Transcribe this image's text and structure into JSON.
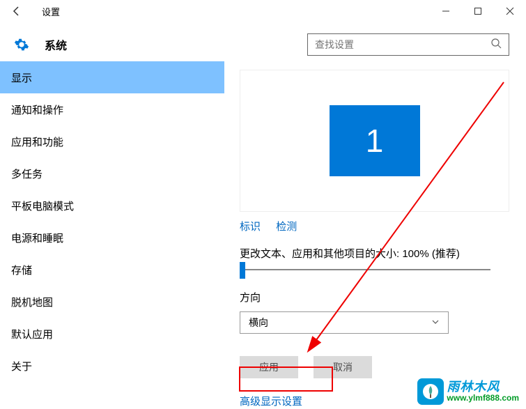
{
  "window": {
    "title": "设置"
  },
  "header": {
    "title": "系统",
    "search_placeholder": "查找设置"
  },
  "sidebar": {
    "items": [
      {
        "label": "显示"
      },
      {
        "label": "通知和操作"
      },
      {
        "label": "应用和功能"
      },
      {
        "label": "多任务"
      },
      {
        "label": "平板电脑模式"
      },
      {
        "label": "电源和睡眠"
      },
      {
        "label": "存储"
      },
      {
        "label": "脱机地图"
      },
      {
        "label": "默认应用"
      },
      {
        "label": "关于"
      }
    ]
  },
  "main": {
    "monitor_number": "1",
    "identify_link": "标识",
    "detect_link": "检测",
    "scale_label": "更改文本、应用和其他项目的大小: 100% (推荐)",
    "orientation_label": "方向",
    "orientation_value": "横向",
    "apply_btn": "应用",
    "cancel_btn": "取消",
    "advanced_link": "高级显示设置"
  },
  "watermark": {
    "title": "雨林木风",
    "url": "www.ylmf888.com"
  }
}
